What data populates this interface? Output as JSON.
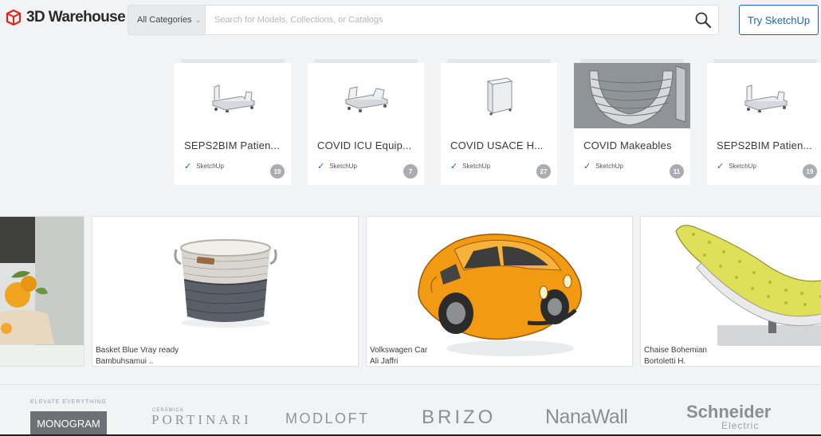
{
  "header": {
    "logo_text": "3D Warehouse",
    "category_label": "All Categories",
    "search_placeholder": "Search for Models, Collections, or Catalogs",
    "try_label": "Try SketchUp"
  },
  "collections": [
    {
      "title": "SEPS2BIM Patien...",
      "source": "SketchUp",
      "count": "19",
      "thumb": "bed-icon"
    },
    {
      "title": "COVID ICU Equip...",
      "source": "SketchUp",
      "count": "7",
      "thumb": "bed-icon"
    },
    {
      "title": "COVID USACE H...",
      "source": "SketchUp",
      "count": "27",
      "thumb": "box-icon"
    },
    {
      "title": "COVID Makeables",
      "source": "SketchUp",
      "count": "11",
      "thumb": "coil-icon"
    },
    {
      "title": "SEPS2BIM Patien...",
      "source": "SketchUp",
      "count": "19",
      "thumb": "bed-icon"
    }
  ],
  "featured": [
    {
      "name": "Basket Blue Vray ready",
      "author": "Bambuhsamui .."
    },
    {
      "name": "Volkswagen Car",
      "author": "Ali Jaffri"
    },
    {
      "name": "Chaise Bohemian",
      "author": "Bortoletti H."
    }
  ],
  "brands": {
    "tagline": "ELEVATE EVERYTHING",
    "monogram": "MONOGRAM",
    "portinari_small": "CERÂMICA",
    "portinari": "PORTINARI",
    "modloft": "MODLOFT",
    "brizo": "BRIZO",
    "nanawall": "NanaWall",
    "schneider": "Schneider",
    "schneider_sub": "Electric"
  },
  "colors": {
    "accent": "#1e64b7",
    "logo_red": "#e2231a",
    "background": "#f2f3f4"
  }
}
